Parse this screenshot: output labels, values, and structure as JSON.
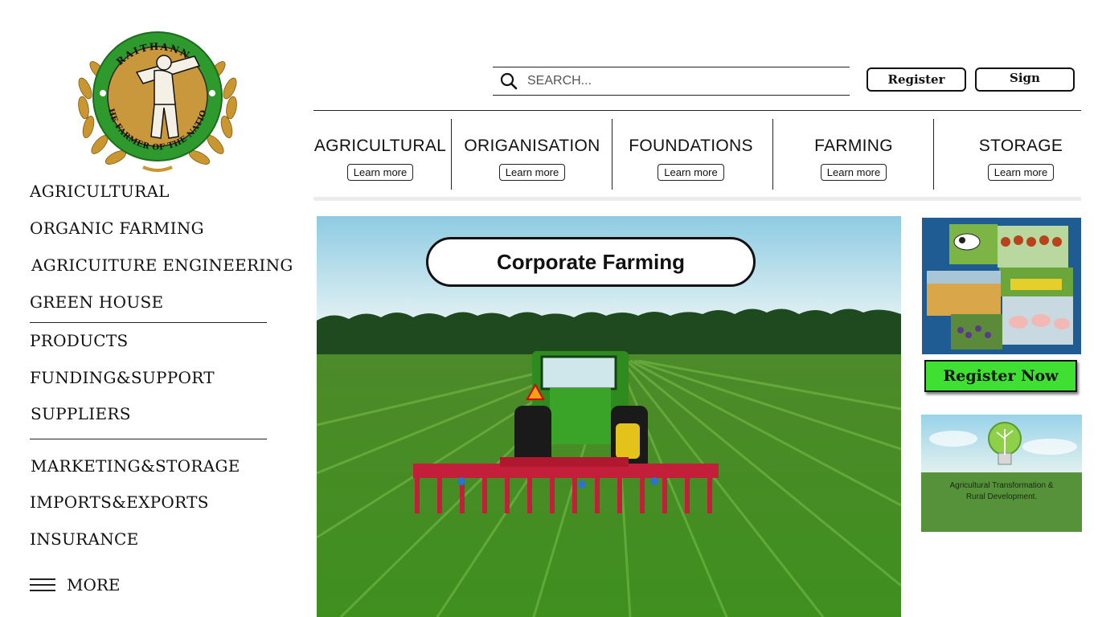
{
  "logo": {
    "top_text": "RAITHANNA",
    "bottom_text": "THE FARMER OF THE NATION"
  },
  "sidebar": {
    "items": [
      {
        "label": "AGRICULTURAL"
      },
      {
        "label": "ORGANIC FARMING"
      },
      {
        "label": "AGRICUITURE ENGINEERING"
      },
      {
        "label": "GREEN HOUSE"
      },
      {
        "label": "PRODUCTS"
      },
      {
        "label": "FUNDING&SUPPORT"
      },
      {
        "label": "SUPPLIERS"
      },
      {
        "label": "MARKETING&STORAGE"
      },
      {
        "label": "IMPORTS&EXPORTS"
      },
      {
        "label": "INSURANCE"
      }
    ],
    "more_label": "MORE",
    "more_icon": "hamburger-menu-icon"
  },
  "header": {
    "search_placeholder": "SEARCH...",
    "search_icon": "search-icon",
    "register_label": "Register",
    "sign_label": "Sign"
  },
  "categories": [
    {
      "title": "AGRICULTURAL",
      "button": "Learn more"
    },
    {
      "title": "ORIGANISATION",
      "button": "Learn more"
    },
    {
      "title": "FOUNDATIONS",
      "button": "Learn more"
    },
    {
      "title": "FARMING",
      "button": "Learn more"
    },
    {
      "title": "STORAGE",
      "button": "Learn more"
    }
  ],
  "hero": {
    "badge": "Corporate Farming"
  },
  "ads": {
    "register_now": "Register Now",
    "banner_line1": "Agricultural Transformation &",
    "banner_line2": "Rural Development."
  },
  "colors": {
    "register_now_bg": "#3fe032",
    "logo_green": "#2e9a2e",
    "logo_gold": "#c99a3a"
  }
}
